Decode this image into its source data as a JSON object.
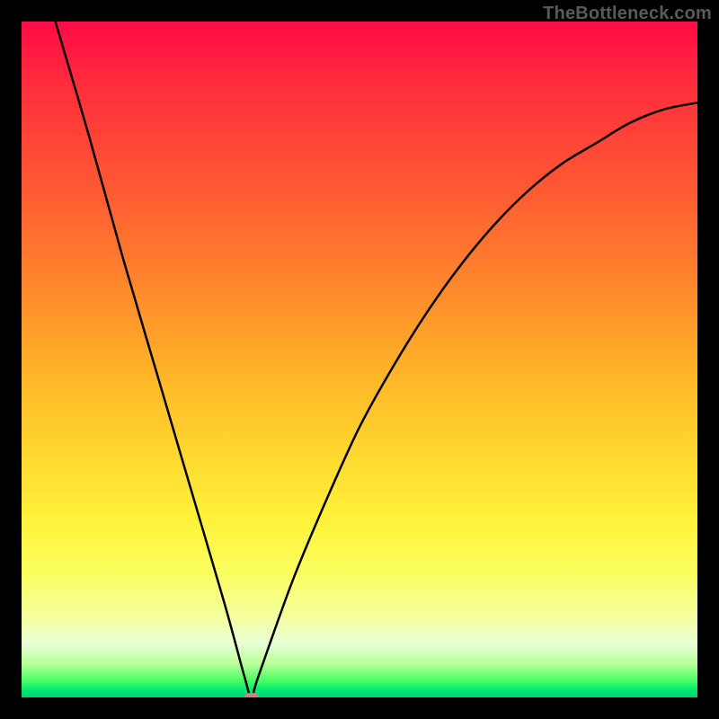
{
  "watermark": "TheBottleneck.com",
  "colors": {
    "frame": "#000000",
    "curve": "#000000",
    "dot": "#d97a84"
  },
  "chart_data": {
    "type": "line",
    "title": "",
    "xlabel": "",
    "ylabel": "",
    "xlim": [
      0,
      100
    ],
    "ylim": [
      0,
      100
    ],
    "grid": false,
    "legend": false,
    "series": [
      {
        "name": "bottleneck-curve",
        "x": [
          5,
          10,
          15,
          20,
          25,
          30,
          33,
          34,
          35,
          40,
          45,
          50,
          55,
          60,
          65,
          70,
          75,
          80,
          85,
          90,
          95,
          100
        ],
        "y": [
          100,
          83,
          65,
          48,
          31,
          14,
          3,
          0,
          3,
          17,
          29,
          40,
          49,
          57,
          64,
          70,
          75,
          79,
          82,
          85,
          87,
          88
        ]
      }
    ],
    "marker": {
      "x": 34,
      "y": 0
    }
  }
}
